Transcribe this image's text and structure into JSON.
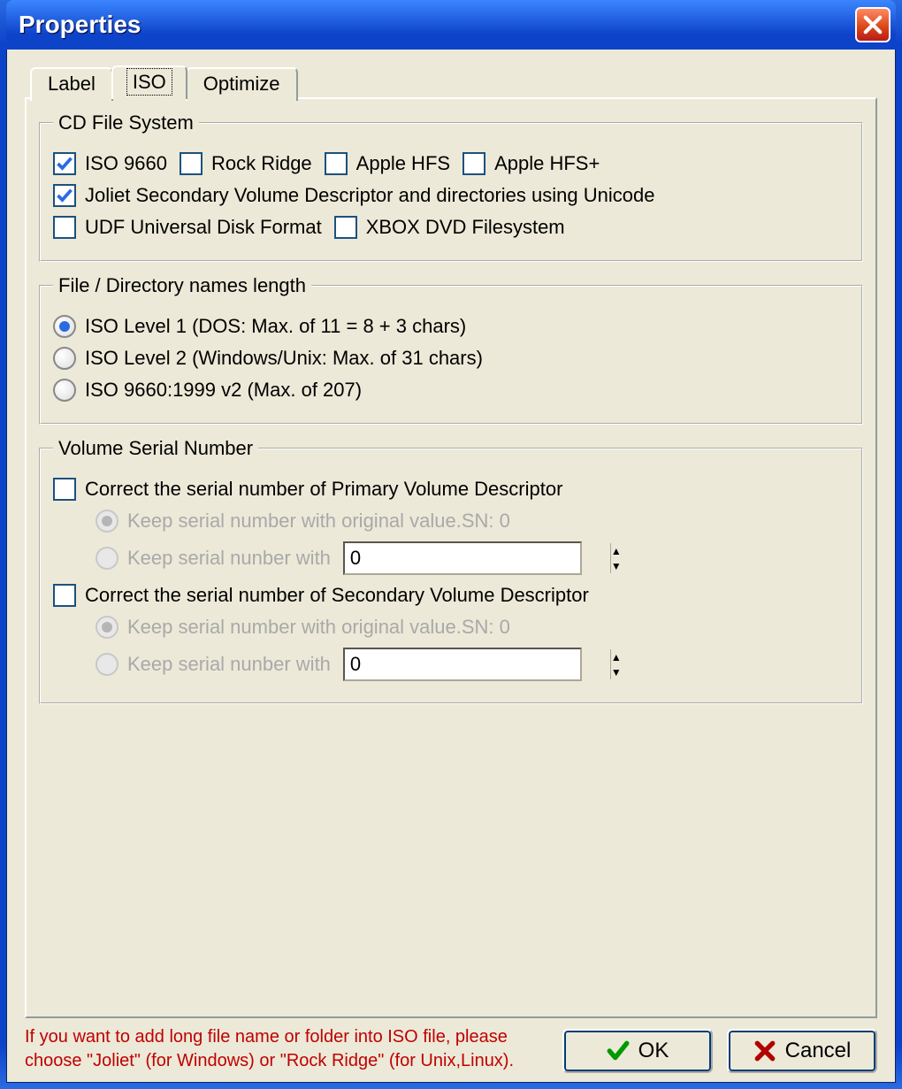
{
  "window": {
    "title": "Properties"
  },
  "tabs": {
    "label": "Label",
    "iso": "ISO",
    "optimize": "Optimize",
    "active": "iso"
  },
  "groups": {
    "filesystem": {
      "legend": "CD File System",
      "iso9660": "ISO 9660",
      "rockridge": "Rock Ridge",
      "applehfs": "Apple HFS",
      "applehfsplus": "Apple HFS+",
      "joliet": "Joliet  Secondary Volume Descriptor and directories using Unicode",
      "udf": "UDF  Universal Disk Format",
      "xbox": "XBOX DVD Filesystem",
      "checked": {
        "iso9660": true,
        "rockridge": false,
        "applehfs": false,
        "applehfsplus": false,
        "joliet": true,
        "udf": false,
        "xbox": false
      }
    },
    "names": {
      "legend": "File / Directory names  length",
      "level1": "ISO Level 1 (DOS: Max. of 11 = 8 + 3 chars)",
      "level2": "ISO Level 2 (Windows/Unix: Max. of 31 chars)",
      "iso1999": "ISO 9660:1999 v2 (Max. of 207)",
      "selected": "level1"
    },
    "vsn": {
      "legend": "Volume Serial Number",
      "correct_primary": "Correct the serial number of  Primary Volume Descriptor",
      "keep_original": "Keep serial number with original value.SN: 0",
      "keep_with": "Keep serial nunber with",
      "spin_value": "0",
      "correct_secondary": "Correct the serial number of  Secondary Volume Descriptor",
      "keep_original2": "Keep serial number with original value.SN: 0",
      "keep_with2": "Keep serial nunber with",
      "spin_value2": "0",
      "primary_checked": false,
      "secondary_checked": false
    }
  },
  "hint": "If you want to add long file name or folder into ISO file, please choose \"Joliet\" (for Windows) or \"Rock Ridge\" (for Unix,Linux).",
  "buttons": {
    "ok": "OK",
    "cancel": "Cancel"
  }
}
